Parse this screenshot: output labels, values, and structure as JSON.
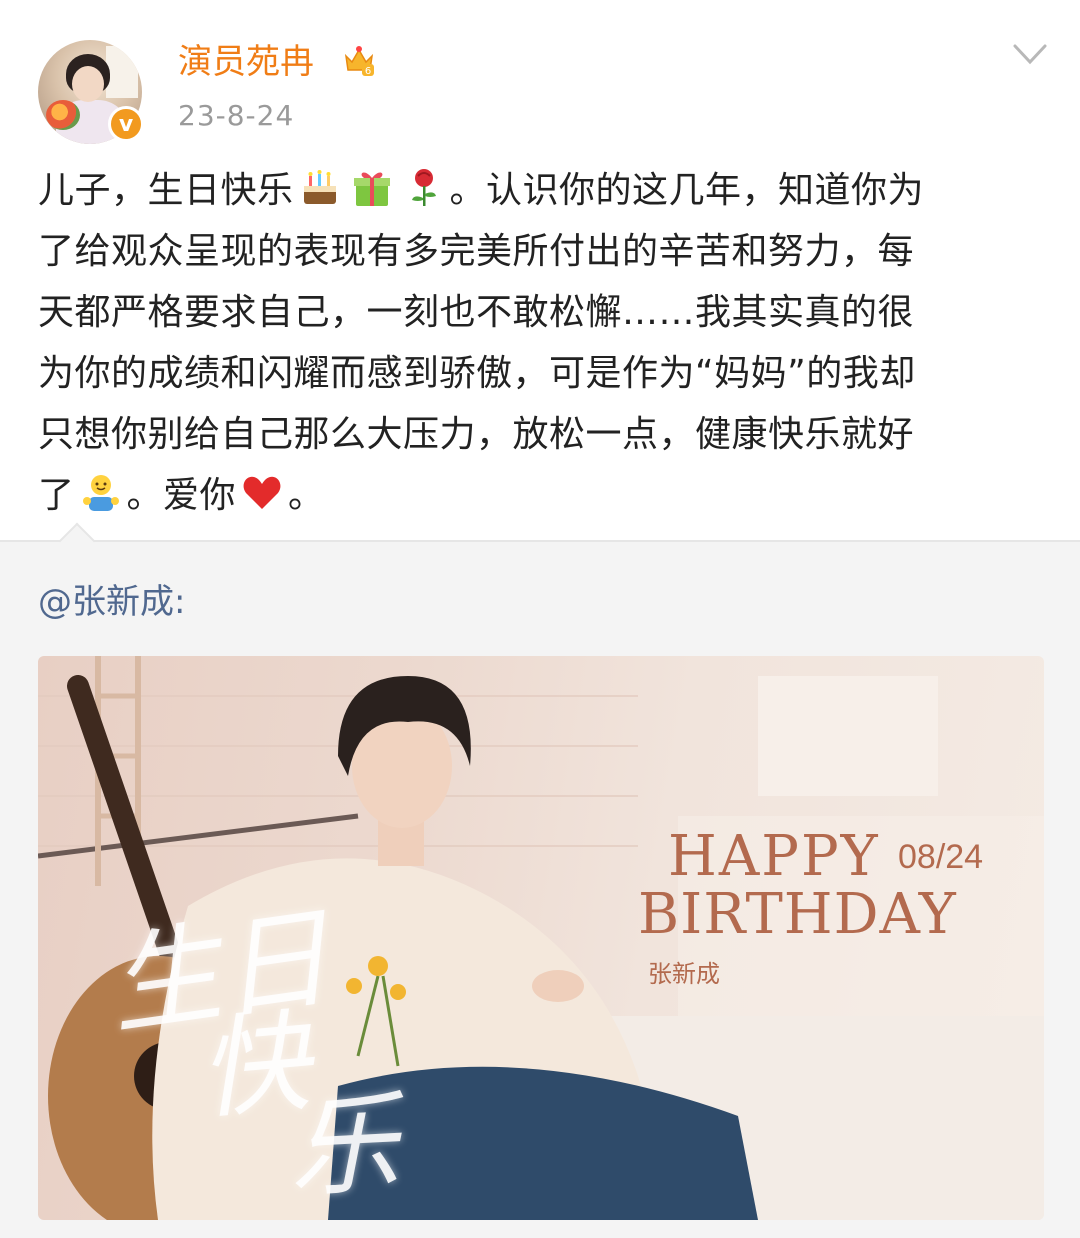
{
  "post": {
    "username": "演员苑冉",
    "timestamp": "23-8-24",
    "content_lines": [
      "儿子，生日快乐",
      "。认识你的这几年，知道你为",
      "了给观众呈现的表现有多完美所付出的辛苦和努力，每",
      "天都严格要求自己，一刻也不敢松懈……我其实真的很",
      "为你的成绩和闪耀而感到骄傲，可是作为“妈妈”的我却",
      "只想你别给自己那么大压力，放松一点，健康快乐就好",
      "了",
      "。爱你",
      "。"
    ],
    "emojis": [
      "cake-icon",
      "gift-icon",
      "rose-icon",
      "hug-icon",
      "heart-icon"
    ]
  },
  "repost": {
    "mention": "@张新成:",
    "image_text": {
      "happy": "HAPPY",
      "date": "08/24",
      "birthday": "BIRTHDAY",
      "name": "张新成",
      "calligraphy_1": "生日",
      "calligraphy_2": "快",
      "calligraphy_3": "乐"
    }
  },
  "colors": {
    "username": "#f07d16",
    "mention": "#50688f",
    "timestamp": "#9a9a9a",
    "verified_badge": "#f29a1f"
  }
}
